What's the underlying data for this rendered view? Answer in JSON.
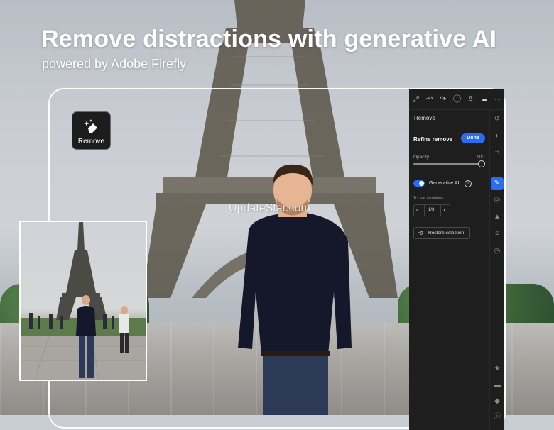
{
  "headline": "Remove distractions with generative AI",
  "subheadline": "powered by Adobe Firefly",
  "badge": {
    "label": "Remove",
    "icon": "eraser-sparkle-icon"
  },
  "watermark": "UpdateStar.com",
  "panel": {
    "title": "Remove",
    "refine_label": "Refine remove",
    "done_label": "Done",
    "opacity_label": "Opacity",
    "opacity_value": "100",
    "opacity_level": 1.0,
    "generative_ai_label": "Generative AI",
    "generative_ai_on": true,
    "variations_label": "Try out variations",
    "variation_counter": "1/3",
    "restore_label": "Restore selection",
    "accent_color": "#2a6df4",
    "toolbar_icons": [
      "expand-icon",
      "undo-icon",
      "redo-icon",
      "help-icon",
      "share-icon",
      "cloud-icon",
      "more-icon"
    ],
    "rail_icons": [
      "history-icon",
      "presets-icon",
      "crop-icon",
      "remove-icon",
      "masking-icon",
      "lock-icon",
      "layers-icon",
      "clock-icon",
      "star-icon",
      "comment-icon",
      "tag-icon",
      "info-icon"
    ]
  }
}
